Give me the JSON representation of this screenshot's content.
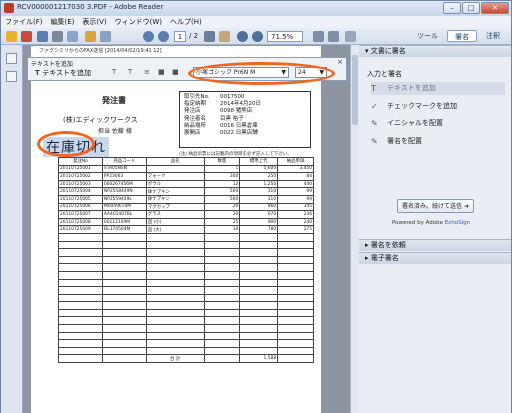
{
  "window": {
    "title": "RCV000001217030 3.PDF - Adobe Reader",
    "min": "–",
    "max": "□",
    "close": "✕"
  },
  "menu": [
    "ファイル(F)",
    "編集(E)",
    "表示(V)",
    "ウィンドウ(W)",
    "ヘルプ(H)"
  ],
  "toolbar": {
    "page_current": "1",
    "page_total": "/ 2",
    "zoom": "71.5%",
    "tabs": [
      "ツール",
      "署名",
      "注釈"
    ]
  },
  "fax_header": "ファクシミリからのFAX送信 [2014/04/02/19:41 12]",
  "text_panel": {
    "caption": "テキストを追加",
    "add_label": "テキストを追加",
    "font": "小塚ゴシック Pr6N M",
    "size": "24",
    "close": "×"
  },
  "document": {
    "title": "発注書",
    "company": "(株)エディックワークス",
    "customer": "担当 佐藤 様",
    "out_of_stock": "在庫切れ",
    "info": [
      {
        "k": "取引先No.",
        "v": "0017500"
      },
      {
        "k": "指定納期",
        "v": "2014年4月20日"
      },
      {
        "k": "発注店",
        "v": "0098 猪熊店"
      },
      {
        "k": "発注者名",
        "v": "目黒 裕子"
      },
      {
        "k": "納品場所",
        "v": "0016 日黒倉庫"
      },
      {
        "k": "展開店",
        "v": "0022 日黒店舗"
      }
    ],
    "note": "(注) 納品伝票には記載内の項目を必ず記入して下さい。",
    "headers": [
      "発注No",
      "商品コード",
      "品名",
      "数量",
      "標準上代",
      "納品単価"
    ],
    "rows": [
      [
        "20110725001",
        "STA05NSN",
        "",
        "1",
        "5,600",
        "3,450"
      ],
      [
        "20110725002",
        "PP23063",
        "フォーク",
        "300",
        "250",
        "84"
      ],
      [
        "20110725003",
        "060267456M",
        "ボウル",
        "12",
        "1,250",
        "440"
      ],
      [
        "20110725004",
        "NP2558449N",
        "鉢ナプキン",
        "500",
        "310",
        "99"
      ],
      [
        "20110725005",
        "NP2559449L",
        "鉢ナプキン",
        "500",
        "310",
        "99"
      ],
      [
        "20110725006",
        "M0049670M",
        "マグカップ",
        "20",
        "860",
        "345"
      ],
      [
        "20110725007",
        "AA401407BL",
        "グラス",
        "20",
        "670",
        "236"
      ],
      [
        "20110725008",
        "00112109M",
        "皿 (小)",
        "25",
        "900",
        "240"
      ],
      [
        "20110725009",
        "DL370504M",
        "皿 (大)",
        "10",
        "780",
        "275"
      ]
    ],
    "empty_rows": 16,
    "total_label": "合 計",
    "total_value": "1,588"
  },
  "right_panel": {
    "section1": "文書に署名",
    "subheader": "入力と署名",
    "items": [
      "テキストを追加",
      "チェックマークを追加",
      "イニシャルを配置",
      "署名を配置"
    ],
    "send_button": "署名済み。続けて送信",
    "powered_prefix": "Powered by Adobe ",
    "powered_brand": "EchoSign",
    "section2": "署名を依頼",
    "section3": "電子署名"
  },
  "colors": {
    "highlight_oval": "#f0661f",
    "accent": "#2a5ca8"
  }
}
